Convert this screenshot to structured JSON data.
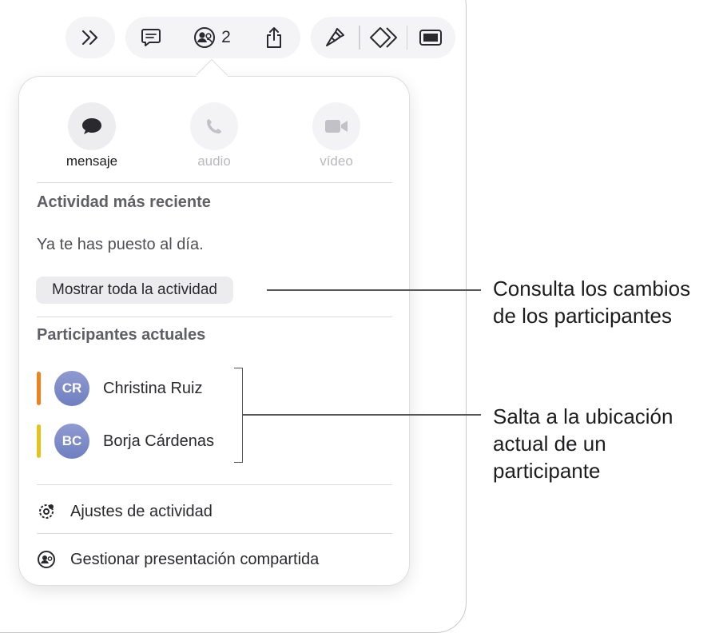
{
  "toolbar": {
    "collaborators_count": "2",
    "buttons": [
      "more-forward-icon",
      "comment-icon",
      "collaborate-icon",
      "share-icon",
      "format-brush-icon",
      "animate-icon",
      "document-sidebar-icon"
    ]
  },
  "popover": {
    "communication": [
      {
        "label": "mensaje",
        "icon": "message-bubble-icon",
        "enabled": true
      },
      {
        "label": "audio",
        "icon": "phone-icon",
        "enabled": false
      },
      {
        "label": "vídeo",
        "icon": "video-camera-icon",
        "enabled": false
      }
    ],
    "recent_activity": {
      "title": "Actividad más reciente",
      "status": "Ya te has puesto al día.",
      "show_all_label": "Mostrar toda la actividad"
    },
    "participants": {
      "title": "Participantes actuales",
      "list": [
        {
          "initials": "CR",
          "name": "Christina Ruiz",
          "color": "#f0811c"
        },
        {
          "initials": "BC",
          "name": "Borja Cárdenas",
          "color": "#e6c21a"
        }
      ]
    },
    "menu": [
      {
        "label": "Ajustes de actividad",
        "icon": "activity-settings-icon"
      },
      {
        "label": "Gestionar presentación compartida",
        "icon": "manage-sharing-icon"
      }
    ]
  },
  "callouts": [
    {
      "line1": "Consulta los cambios",
      "line2": "de los participantes",
      "line3": ""
    },
    {
      "line1": "Salta a la ubicación",
      "line2": "actual de un",
      "line3": "participante"
    }
  ]
}
